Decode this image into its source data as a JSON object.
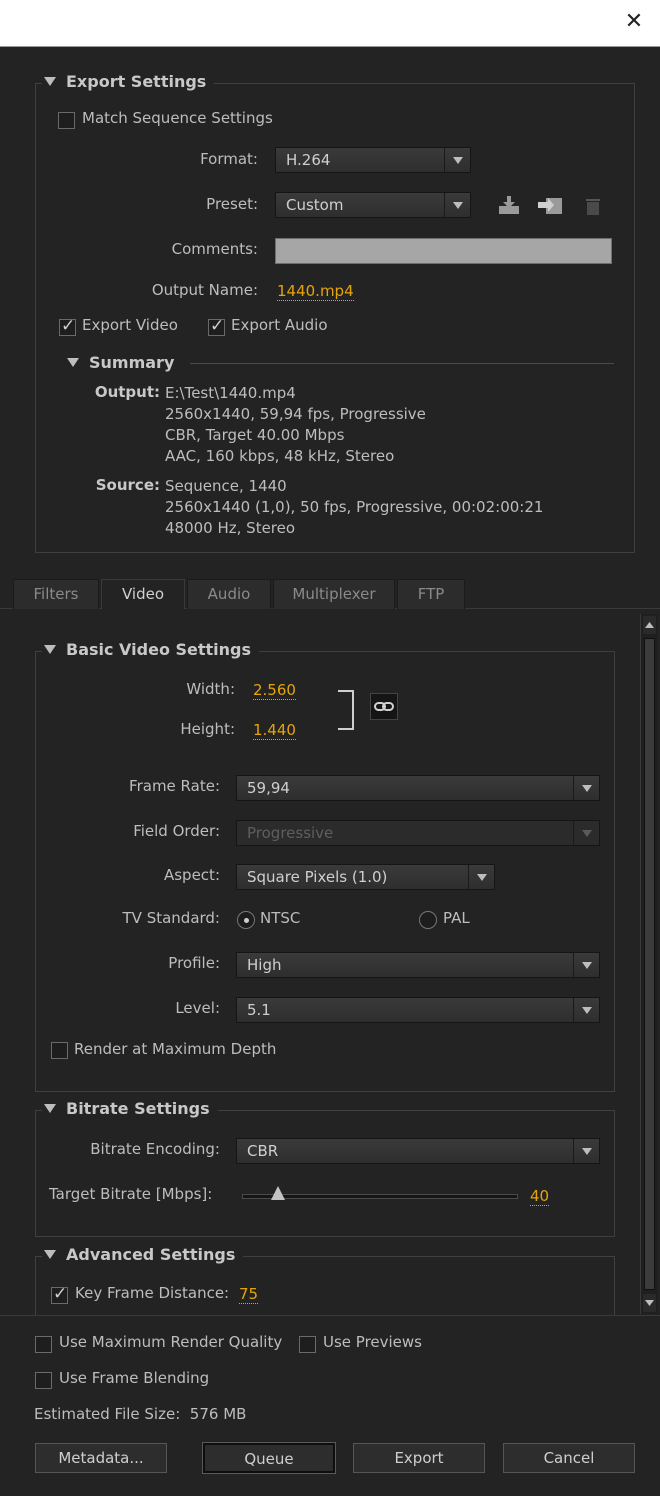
{
  "window": {
    "close_glyph": "✕"
  },
  "export_settings": {
    "heading": "Export Settings",
    "match_sequence_label": "Match Sequence Settings",
    "match_sequence_checked": false,
    "format_label": "Format:",
    "format_value": "H.264",
    "preset_label": "Preset:",
    "preset_value": "Custom",
    "comments_label": "Comments:",
    "comments_value": "",
    "output_name_label": "Output Name:",
    "output_name_value": "1440.mp4",
    "export_video_label": "Export Video",
    "export_video_checked": true,
    "export_audio_label": "Export Audio",
    "export_audio_checked": true,
    "preset_icons": [
      "save-preset-icon",
      "import-preset-icon",
      "delete-preset-icon"
    ]
  },
  "summary": {
    "heading": "Summary",
    "output_key": "Output:",
    "output_lines": [
      "E:\\Test\\1440.mp4",
      "2560x1440, 59,94 fps, Progressive",
      "CBR, Target 40.00 Mbps",
      "AAC, 160 kbps, 48 kHz, Stereo"
    ],
    "source_key": "Source:",
    "source_lines": [
      "Sequence, 1440",
      "2560x1440 (1,0), 50 fps, Progressive, 00:02:00:21",
      "48000 Hz, Stereo"
    ]
  },
  "tabs": [
    {
      "label": "Filters",
      "active": false
    },
    {
      "label": "Video",
      "active": true
    },
    {
      "label": "Audio",
      "active": false
    },
    {
      "label": "Multiplexer",
      "active": false
    },
    {
      "label": "FTP",
      "active": false
    }
  ],
  "basic_video": {
    "heading": "Basic Video Settings",
    "width_label": "Width:",
    "width_value": "2.560",
    "height_label": "Height:",
    "height_value": "1.440",
    "frame_rate_label": "Frame Rate:",
    "frame_rate_value": "59,94",
    "field_order_label": "Field Order:",
    "field_order_value": "Progressive",
    "aspect_label": "Aspect:",
    "aspect_value": "Square Pixels (1.0)",
    "tv_standard_label": "TV Standard:",
    "ntsc_label": "NTSC",
    "pal_label": "PAL",
    "tv_standard_selected": "NTSC",
    "profile_label": "Profile:",
    "profile_value": "High",
    "level_label": "Level:",
    "level_value": "5.1",
    "render_max_depth_label": "Render at Maximum Depth",
    "render_max_depth_checked": false
  },
  "bitrate": {
    "heading": "Bitrate Settings",
    "encoding_label": "Bitrate Encoding:",
    "encoding_value": "CBR",
    "target_label": "Target Bitrate [Mbps]:",
    "target_value": "40",
    "slider_fraction": 0.13
  },
  "advanced": {
    "heading": "Advanced Settings",
    "key_frame_label": "Key Frame Distance:",
    "key_frame_checked": true,
    "key_frame_value": "75"
  },
  "footer": {
    "max_render_quality_label": "Use Maximum Render Quality",
    "use_previews_label": "Use Previews",
    "frame_blending_label": "Use Frame Blending",
    "estimated_size": "Estimated File Size:  576 MB",
    "buttons": {
      "metadata": "Metadata...",
      "queue": "Queue",
      "export": "Export",
      "cancel": "Cancel"
    }
  },
  "colors": {
    "accent_value": "#e5a50a",
    "background": "#232323"
  }
}
